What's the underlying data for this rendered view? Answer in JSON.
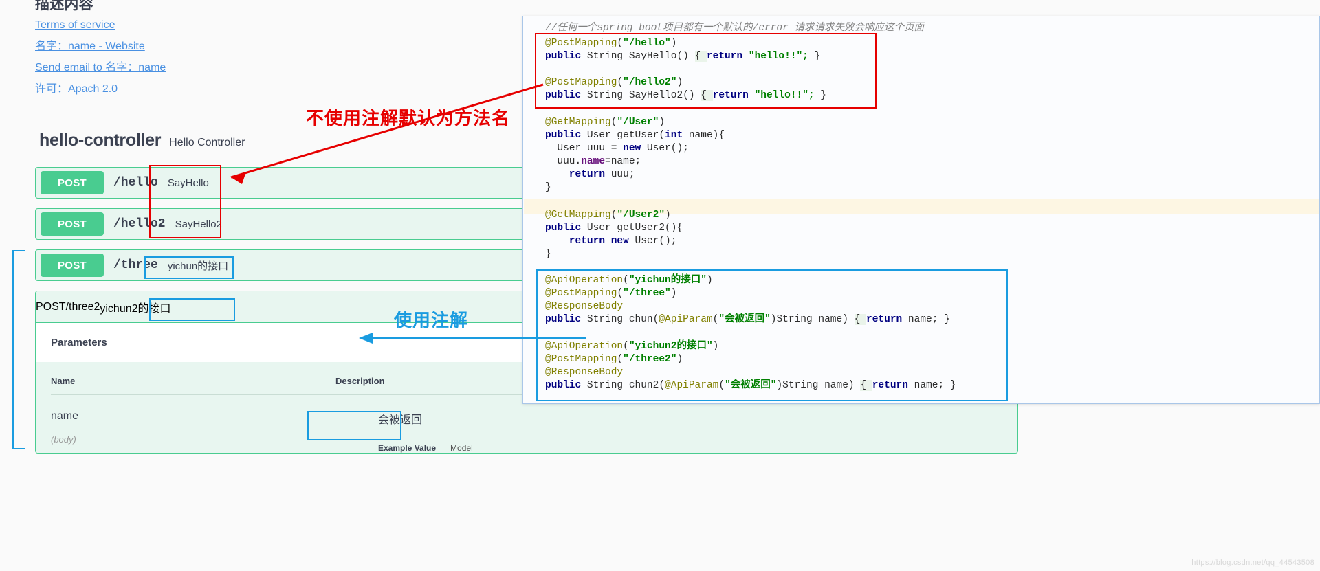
{
  "swagger": {
    "info_description_title": "描述内容",
    "links": [
      {
        "label": "Terms of service"
      },
      {
        "label": "名字：name - Website"
      },
      {
        "label": "Send email to 名字：name"
      },
      {
        "label": "许可：Apach 2.0"
      }
    ],
    "controller": {
      "name": "hello-controller",
      "description": "Hello Controller"
    },
    "operations": [
      {
        "verb": "POST",
        "path": "/hello",
        "summary": "SayHello"
      },
      {
        "verb": "POST",
        "path": "/hello2",
        "summary": "SayHello2"
      },
      {
        "verb": "POST",
        "path": "/three",
        "summary": "yichun的接口"
      },
      {
        "verb": "POST",
        "path": "/three2",
        "summary": "yichun2的接口"
      }
    ],
    "parameters_section": {
      "title": "Parameters",
      "columns": {
        "name": "Name",
        "description": "Description"
      },
      "rows": [
        {
          "name": "name",
          "in": "(body)",
          "description": "会被返回"
        }
      ],
      "example_value_label": "Example Value",
      "model_label": "Model"
    }
  },
  "code_panel": {
    "comment": "//任何一个spring boot项目都有一个默认的/error 请求请求失败会响应这个页面",
    "blocks": {
      "hello": {
        "ann1": "@PostMapping",
        "path1": "\"/hello\"",
        "sig1_kw": "public",
        "sig1_rest": " String SayHello() ",
        "body1_open": "{ ",
        "body1_return": "return",
        "body1_val": " \"hello!!\"; ",
        "body1_close": "}",
        "ann2": "@PostMapping",
        "path2": "\"/hello2\"",
        "sig2_kw": "public",
        "sig2_rest": " String SayHello2() ",
        "body2_open": "{ ",
        "body2_return": "return",
        "body2_val": " \"hello!!\"; ",
        "body2_close": "}"
      },
      "user": {
        "ann": "@GetMapping",
        "path": "\"/User\"",
        "sig_kw": "public",
        "sig_rest": " User getUser(",
        "sig_int": "int",
        "sig_tail": " name){",
        "l1": "  User uuu = ",
        "l1_new": "new",
        "l1_tail": " User();",
        "l2_a": "  uuu.",
        "l2_fld": "name",
        "l2_b": "=name;",
        "l3_kw": "    return",
        "l3_tail": " uuu;",
        "l4": "}"
      },
      "user2": {
        "ann": "@GetMapping",
        "path": "\"/User2\"",
        "sig_kw": "public",
        "sig_rest": " User getUser2(){",
        "l1_kw": "    return new",
        "l1_tail": " User();",
        "l2": "}"
      },
      "three": {
        "ann_op": "@ApiOperation",
        "ann_op_val": "\"yichun的接口\"",
        "ann_map": "@PostMapping",
        "ann_map_val": "\"/three\"",
        "ann_rb": "@ResponseBody",
        "sig_kw": "public",
        "sig_a": " String chun(",
        "sig_param_ann": "@ApiParam",
        "sig_param_val": "\"会被返回\"",
        "sig_b": ")String name) ",
        "body_open": "{ ",
        "body_return": "return",
        "body_tail": " name; ",
        "body_close": "}"
      },
      "three2": {
        "ann_op": "@ApiOperation",
        "ann_op_val": "\"yichun2的接口\"",
        "ann_map": "@PostMapping",
        "ann_map_val": "\"/three2\"",
        "ann_rb": "@ResponseBody",
        "sig_kw": "public",
        "sig_a": " String chun2(",
        "sig_param_ann": "@ApiParam",
        "sig_param_val": "\"会被返回\"",
        "sig_b": ")String name) ",
        "body_open": "{ ",
        "body_return": "return",
        "body_tail": " name; ",
        "body_close": "}"
      }
    }
  },
  "annotations": {
    "red_note": "不使用注解默认为方法名",
    "blue_note": "使用注解",
    "red_color": "#e60000",
    "blue_color": "#1a9ce0",
    "green_color": "#49cc90"
  },
  "watermark": "https://blog.csdn.net/qq_44543508"
}
